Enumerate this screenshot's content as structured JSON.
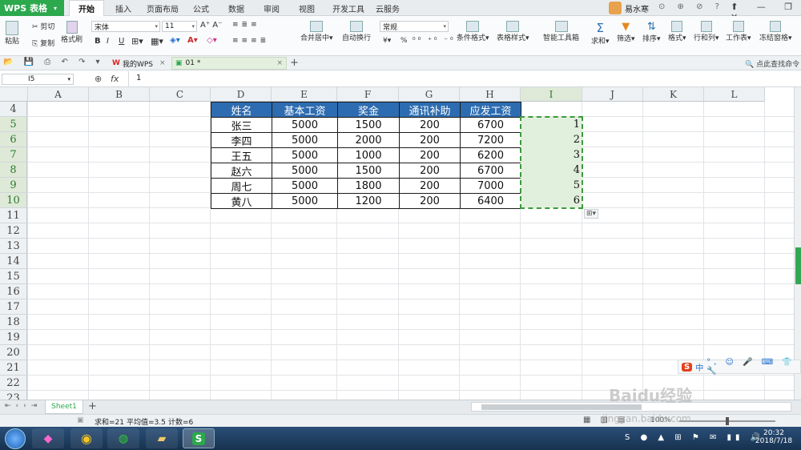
{
  "app": {
    "name": "WPS 表格"
  },
  "menu_tabs": [
    "开始",
    "插入",
    "页面布局",
    "公式",
    "数据",
    "审阅",
    "视图",
    "开发工具",
    "云服务"
  ],
  "user": {
    "name": "易水寒"
  },
  "ribbon": {
    "paste": "粘贴",
    "cut": "剪切",
    "copy": "复制",
    "format_painter": "格式刷",
    "font_name": "宋体",
    "font_size": "11",
    "bold": "B",
    "italic": "I",
    "underline": "U",
    "merge_center": "合并居中",
    "wrap_text": "自动换行",
    "number_format": "常规",
    "percent": "%",
    "conditional_format": "条件格式",
    "table_style": "表格样式",
    "smart_toolbox": "智能工具箱",
    "sum": "求和",
    "filter": "筛选",
    "sort": "排序",
    "format": "格式",
    "row_col": "行和列",
    "worksheet": "工作表",
    "freeze": "冻结窗格",
    "find_cmd": "点此查找命令"
  },
  "doc_tabs": [
    {
      "label": "我的WPS"
    },
    {
      "label": "01 *"
    }
  ],
  "formula_bar": {
    "cell_ref": "I5",
    "fx": "fx",
    "value": "1"
  },
  "columns": [
    "A",
    "B",
    "C",
    "D",
    "E",
    "F",
    "G",
    "H",
    "I",
    "J",
    "K",
    "L"
  ],
  "rows": [
    "4",
    "5",
    "6",
    "7",
    "8",
    "9",
    "10",
    "11",
    "12",
    "13",
    "14",
    "15",
    "16",
    "17",
    "18",
    "19",
    "20",
    "21",
    "22",
    "23"
  ],
  "table": {
    "headers": [
      "姓名",
      "基本工资",
      "奖金",
      "通讯补助",
      "应发工资"
    ],
    "rows": [
      [
        "张三",
        "5000",
        "1500",
        "200",
        "6700",
        "1"
      ],
      [
        "李四",
        "5000",
        "2000",
        "200",
        "7200",
        "2"
      ],
      [
        "王五",
        "5000",
        "1000",
        "200",
        "6200",
        "3"
      ],
      [
        "赵六",
        "5000",
        "1500",
        "200",
        "6700",
        "4"
      ],
      [
        "周七",
        "5000",
        "1800",
        "200",
        "7000",
        "5"
      ],
      [
        "黄八",
        "5000",
        "1200",
        "200",
        "6400",
        "6"
      ]
    ]
  },
  "sheet_tabs": [
    "Sheet1"
  ],
  "status": {
    "sum": "求和=21",
    "avg": "平均值=3.5",
    "count": "计数=6",
    "zoom": "100%"
  },
  "ime": {
    "label": "中"
  },
  "watermark": {
    "text": "Baidu经验",
    "url": "jingyan.baidu.com"
  },
  "clock": {
    "time": "20:32",
    "date": "2018/7/18"
  },
  "colors": {
    "accent": "#2ca84d",
    "header_fill": "#2d6cb0",
    "selection_fill": "#e1f0dd"
  }
}
